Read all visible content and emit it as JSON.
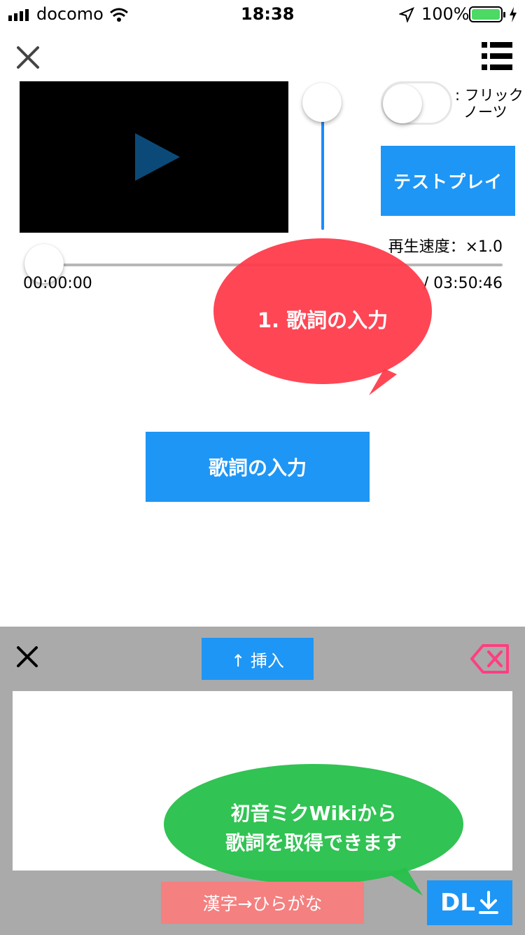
{
  "status_bar": {
    "carrier": "docomo",
    "time": "18:38",
    "battery": "100%"
  },
  "player": {
    "flick_label_line1": ": フリック",
    "flick_label_line2": "ノーツ",
    "flick_toggle_on": false,
    "test_play_label": "テストプレイ",
    "speed_label": "再生速度：×1.0",
    "current_time": "00:00:00",
    "total_time": "/ 03:50:46",
    "seek_progress": 0
  },
  "callouts": {
    "step1": "1. 歌詞の入力",
    "wiki_line1": "初音ミクWikiから",
    "wiki_line2": "歌詞を取得できます"
  },
  "main": {
    "lyrics_button": "歌詞の入力"
  },
  "panel": {
    "insert_label": "↑ 挿入",
    "lyrics_text": "",
    "kanji_button": "漢字→ひらがな",
    "dl_button": "DL"
  },
  "colors": {
    "accent_blue": "#1e96f5",
    "callout_red": "#ff4656",
    "callout_green": "#26c04a",
    "kanji_pink": "#f48080",
    "panel_gray": "#aaaaaa"
  }
}
